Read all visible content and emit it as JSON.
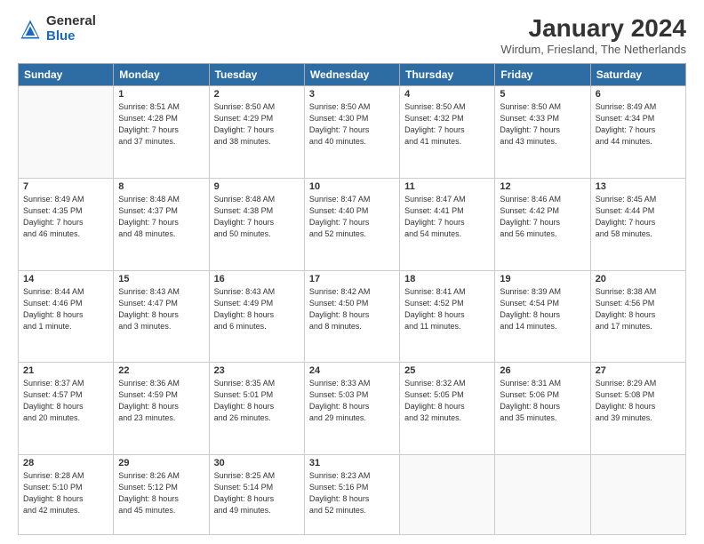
{
  "header": {
    "logo_general": "General",
    "logo_blue": "Blue",
    "month_title": "January 2024",
    "location": "Wirdum, Friesland, The Netherlands"
  },
  "weekdays": [
    "Sunday",
    "Monday",
    "Tuesday",
    "Wednesday",
    "Thursday",
    "Friday",
    "Saturday"
  ],
  "weeks": [
    [
      {
        "day": "",
        "info": ""
      },
      {
        "day": "1",
        "info": "Sunrise: 8:51 AM\nSunset: 4:28 PM\nDaylight: 7 hours\nand 37 minutes."
      },
      {
        "day": "2",
        "info": "Sunrise: 8:50 AM\nSunset: 4:29 PM\nDaylight: 7 hours\nand 38 minutes."
      },
      {
        "day": "3",
        "info": "Sunrise: 8:50 AM\nSunset: 4:30 PM\nDaylight: 7 hours\nand 40 minutes."
      },
      {
        "day": "4",
        "info": "Sunrise: 8:50 AM\nSunset: 4:32 PM\nDaylight: 7 hours\nand 41 minutes."
      },
      {
        "day": "5",
        "info": "Sunrise: 8:50 AM\nSunset: 4:33 PM\nDaylight: 7 hours\nand 43 minutes."
      },
      {
        "day": "6",
        "info": "Sunrise: 8:49 AM\nSunset: 4:34 PM\nDaylight: 7 hours\nand 44 minutes."
      }
    ],
    [
      {
        "day": "7",
        "info": "Sunrise: 8:49 AM\nSunset: 4:35 PM\nDaylight: 7 hours\nand 46 minutes."
      },
      {
        "day": "8",
        "info": "Sunrise: 8:48 AM\nSunset: 4:37 PM\nDaylight: 7 hours\nand 48 minutes."
      },
      {
        "day": "9",
        "info": "Sunrise: 8:48 AM\nSunset: 4:38 PM\nDaylight: 7 hours\nand 50 minutes."
      },
      {
        "day": "10",
        "info": "Sunrise: 8:47 AM\nSunset: 4:40 PM\nDaylight: 7 hours\nand 52 minutes."
      },
      {
        "day": "11",
        "info": "Sunrise: 8:47 AM\nSunset: 4:41 PM\nDaylight: 7 hours\nand 54 minutes."
      },
      {
        "day": "12",
        "info": "Sunrise: 8:46 AM\nSunset: 4:42 PM\nDaylight: 7 hours\nand 56 minutes."
      },
      {
        "day": "13",
        "info": "Sunrise: 8:45 AM\nSunset: 4:44 PM\nDaylight: 7 hours\nand 58 minutes."
      }
    ],
    [
      {
        "day": "14",
        "info": "Sunrise: 8:44 AM\nSunset: 4:46 PM\nDaylight: 8 hours\nand 1 minute."
      },
      {
        "day": "15",
        "info": "Sunrise: 8:43 AM\nSunset: 4:47 PM\nDaylight: 8 hours\nand 3 minutes."
      },
      {
        "day": "16",
        "info": "Sunrise: 8:43 AM\nSunset: 4:49 PM\nDaylight: 8 hours\nand 6 minutes."
      },
      {
        "day": "17",
        "info": "Sunrise: 8:42 AM\nSunset: 4:50 PM\nDaylight: 8 hours\nand 8 minutes."
      },
      {
        "day": "18",
        "info": "Sunrise: 8:41 AM\nSunset: 4:52 PM\nDaylight: 8 hours\nand 11 minutes."
      },
      {
        "day": "19",
        "info": "Sunrise: 8:39 AM\nSunset: 4:54 PM\nDaylight: 8 hours\nand 14 minutes."
      },
      {
        "day": "20",
        "info": "Sunrise: 8:38 AM\nSunset: 4:56 PM\nDaylight: 8 hours\nand 17 minutes."
      }
    ],
    [
      {
        "day": "21",
        "info": "Sunrise: 8:37 AM\nSunset: 4:57 PM\nDaylight: 8 hours\nand 20 minutes."
      },
      {
        "day": "22",
        "info": "Sunrise: 8:36 AM\nSunset: 4:59 PM\nDaylight: 8 hours\nand 23 minutes."
      },
      {
        "day": "23",
        "info": "Sunrise: 8:35 AM\nSunset: 5:01 PM\nDaylight: 8 hours\nand 26 minutes."
      },
      {
        "day": "24",
        "info": "Sunrise: 8:33 AM\nSunset: 5:03 PM\nDaylight: 8 hours\nand 29 minutes."
      },
      {
        "day": "25",
        "info": "Sunrise: 8:32 AM\nSunset: 5:05 PM\nDaylight: 8 hours\nand 32 minutes."
      },
      {
        "day": "26",
        "info": "Sunrise: 8:31 AM\nSunset: 5:06 PM\nDaylight: 8 hours\nand 35 minutes."
      },
      {
        "day": "27",
        "info": "Sunrise: 8:29 AM\nSunset: 5:08 PM\nDaylight: 8 hours\nand 39 minutes."
      }
    ],
    [
      {
        "day": "28",
        "info": "Sunrise: 8:28 AM\nSunset: 5:10 PM\nDaylight: 8 hours\nand 42 minutes."
      },
      {
        "day": "29",
        "info": "Sunrise: 8:26 AM\nSunset: 5:12 PM\nDaylight: 8 hours\nand 45 minutes."
      },
      {
        "day": "30",
        "info": "Sunrise: 8:25 AM\nSunset: 5:14 PM\nDaylight: 8 hours\nand 49 minutes."
      },
      {
        "day": "31",
        "info": "Sunrise: 8:23 AM\nSunset: 5:16 PM\nDaylight: 8 hours\nand 52 minutes."
      },
      {
        "day": "",
        "info": ""
      },
      {
        "day": "",
        "info": ""
      },
      {
        "day": "",
        "info": ""
      }
    ]
  ]
}
